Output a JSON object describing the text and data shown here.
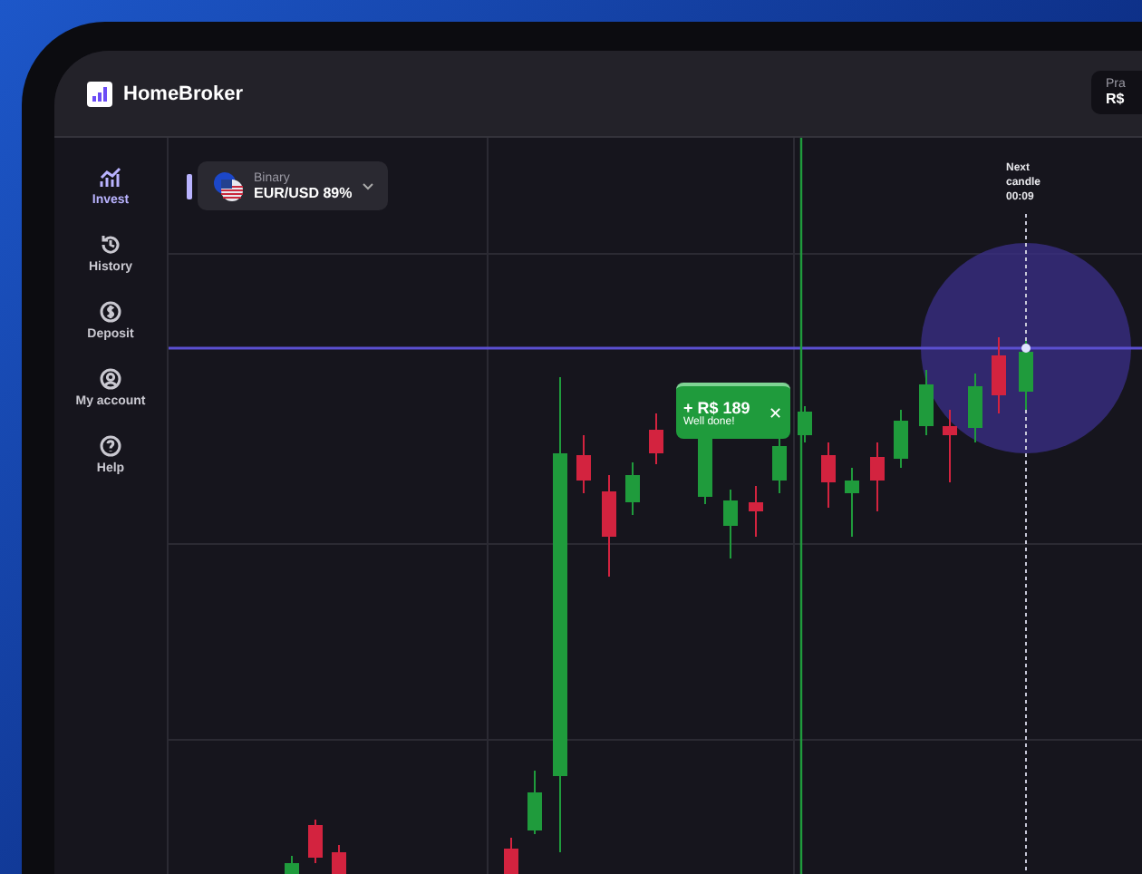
{
  "app": {
    "name": "HomeBroker"
  },
  "account_box": {
    "label": "Pra",
    "value": "R$"
  },
  "sidebar": {
    "items": [
      {
        "label": "Invest",
        "kind": "chart",
        "selected": true
      },
      {
        "label": "History",
        "kind": "history",
        "selected": false
      },
      {
        "label": "Deposit",
        "kind": "dollar",
        "selected": false
      },
      {
        "label": "My account",
        "kind": "user",
        "selected": false
      },
      {
        "label": "Help",
        "kind": "help",
        "selected": false
      }
    ]
  },
  "asset_selector": {
    "type": "Binary",
    "pair": "EUR/USD 89%"
  },
  "next_candle": {
    "label": "Next candle",
    "time": "00:09"
  },
  "trade_popup": {
    "amount": "+ R$ 189",
    "message": "Well done!",
    "close": "✕"
  }
}
